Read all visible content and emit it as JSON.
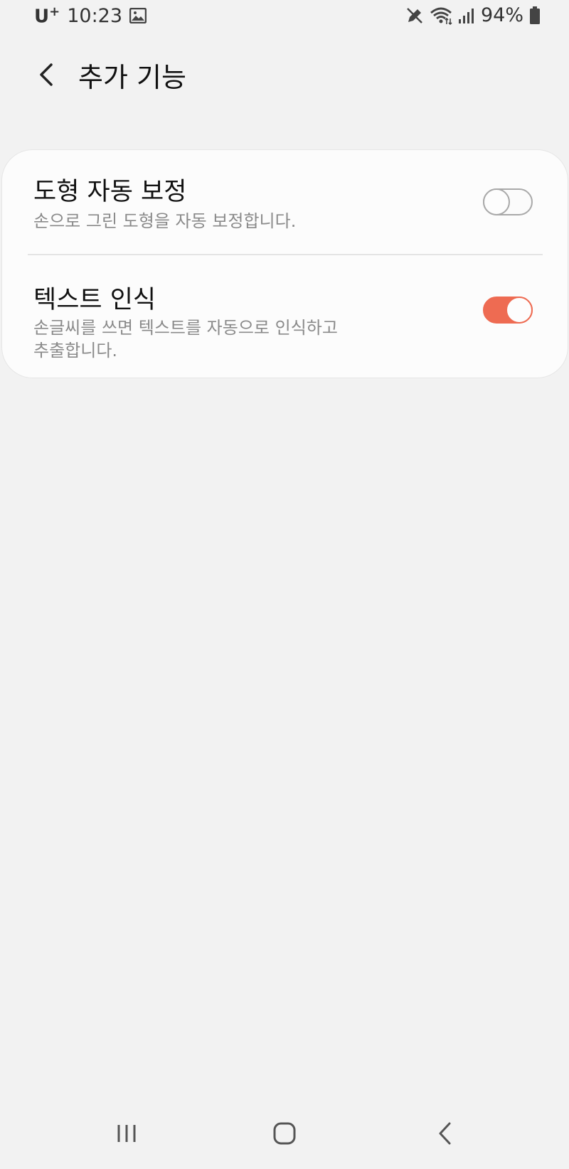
{
  "status_bar": {
    "carrier": "U",
    "carrier_sup": "+",
    "time": "10:23",
    "battery": "94%",
    "icons": [
      "gallery-icon",
      "pen-icon",
      "wifi-icon",
      "signal-icon",
      "battery-icon"
    ]
  },
  "header": {
    "title": "추가 기능",
    "back_icon": "back-arrow-icon"
  },
  "settings": [
    {
      "title": "도형 자동 보정",
      "description": "손으로 그린 도형을 자동 보정합니다.",
      "enabled": false
    },
    {
      "title": "텍스트 인식",
      "description_line1": "손글씨를 쓰면 텍스트를 자동으로 인식하고",
      "description_line2": "추출합니다.",
      "enabled": true
    }
  ],
  "colors": {
    "background": "#f2f2f2",
    "card": "#fcfcfc",
    "accent": "#ee6b52",
    "toggle_off": "#a9a9a9"
  },
  "nav_bar": {
    "icons": [
      "recents-icon",
      "home-icon",
      "back-icon"
    ]
  }
}
